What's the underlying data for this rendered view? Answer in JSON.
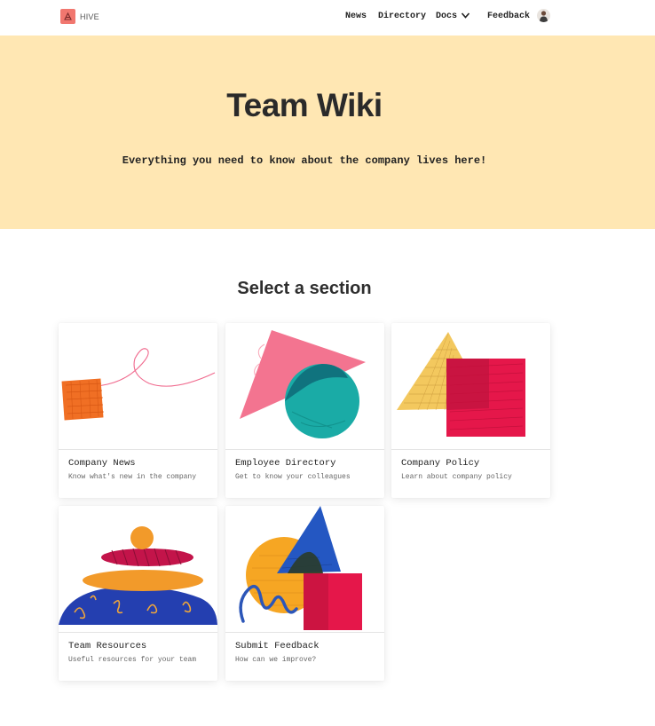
{
  "nav": {
    "logo_text": "HIVE",
    "links": [
      {
        "label": "News"
      },
      {
        "label": "Directory"
      },
      {
        "label": "Docs"
      },
      {
        "label": "Feedback"
      }
    ]
  },
  "hero": {
    "title": "Team Wiki",
    "subtitle": "Everything you need to know about the company lives here!"
  },
  "sections": {
    "heading": "Select a section",
    "cards": [
      {
        "title": "Company News",
        "description": "Know what's new in the company"
      },
      {
        "title": "Employee Directory",
        "description": "Get to know your colleagues"
      },
      {
        "title": "Company Policy",
        "description": "Learn about company policy"
      },
      {
        "title": "Team Resources",
        "description": "Useful resources for your team"
      },
      {
        "title": "Submit Feedback",
        "description": "How can we improve?"
      }
    ]
  },
  "colors": {
    "hero_background": "#ffe7b3",
    "logo_accent": "#f1776f",
    "pink": "#f26d8a",
    "teal": "#19aaa6",
    "yellow": "#f3c85e",
    "crimson": "#e5174a",
    "orange": "#f29a2a",
    "blue": "#2c56b8"
  }
}
